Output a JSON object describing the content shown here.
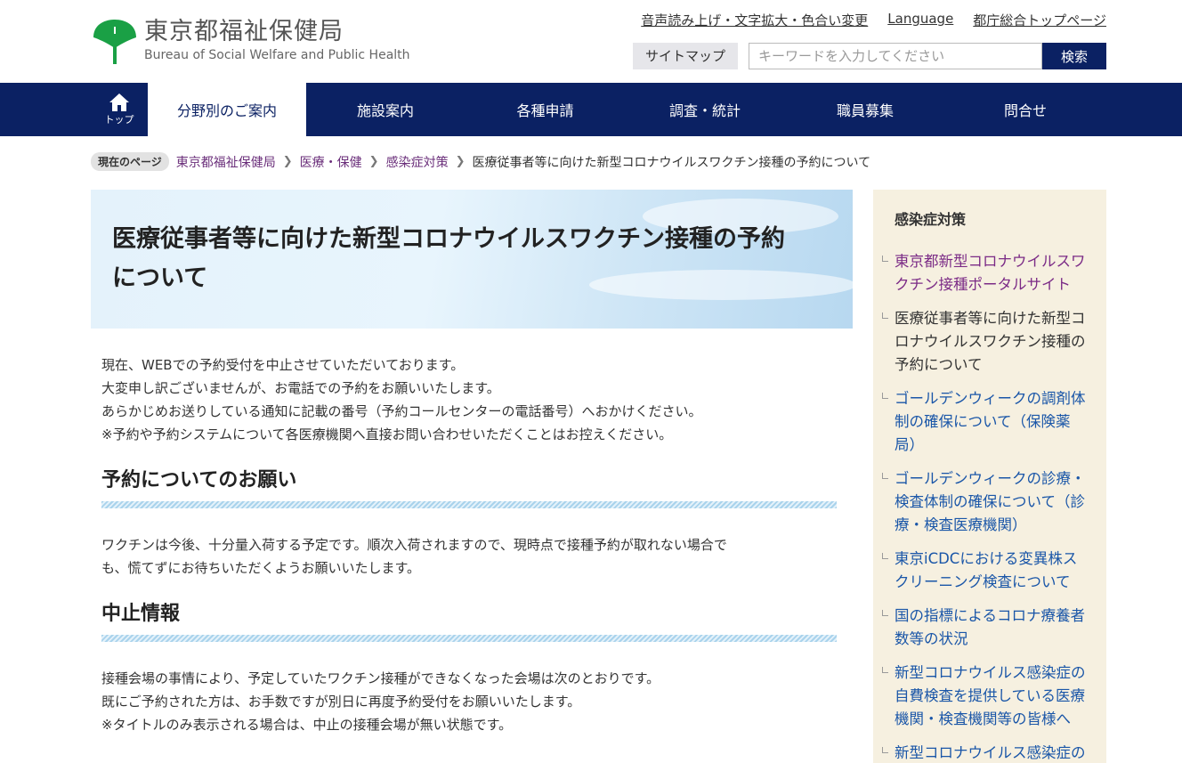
{
  "header": {
    "logo_ja": "東京都福祉保健局",
    "logo_en": "Bureau of Social Welfare and Public Health",
    "util_links": [
      "音声読み上げ・文字拡大・色合い変更",
      "Language",
      "都庁総合トップページ"
    ],
    "sitemap": "サイトマップ",
    "search_placeholder": "キーワードを入力してください",
    "search_button": "検索",
    "logo_color": "#1aa045"
  },
  "nav": {
    "home_label": "トップ",
    "items": [
      "分野別のご案内",
      "施設案内",
      "各種申請",
      "調査・統計",
      "職員募集",
      "問合せ"
    ],
    "active_index": 0,
    "color": "#0b2163"
  },
  "breadcrumb": {
    "current_label": "現在のページ",
    "links": [
      "東京都福祉保健局",
      "医療・保健",
      "感染症対策"
    ],
    "current": "医療従事者等に向けた新型コロナウイルスワクチン接種の予約について"
  },
  "main": {
    "title_line1": "医療従事者等に向けた新型コロナウイルスワクチン接種の予約",
    "title_line2": "について",
    "intro": [
      "現在、WEBでの予約受付を中止させていただいております。",
      "大変申し訳ございませんが、お電話での予約をお願いいたします。",
      "あらかじめお送りしている通知に記載の番号（予約コールセンターの電話番号）へおかけください。",
      "※予約や予約システムについて各医療機関へ直接お問い合わせいただくことはお控えください。"
    ],
    "section1": {
      "heading": "予約についてのお願い",
      "lines": [
        "ワクチンは今後、十分量入荷する予定です。順次入荷されますので、現時点で接種予約が取れない場合で",
        "も、慌てずにお待ちいただくようお願いいたします。"
      ]
    },
    "section2": {
      "heading": "中止情報",
      "lines": [
        "接種会場の事情により、予定していたワクチン接種ができなくなった会場は次のとおりです。",
        "既にご予約された方は、お手数ですが別日に再度予約受付をお願いいたします。",
        "※タイトルのみ表示される場合は、中止の接種会場が無い状態です。"
      ]
    }
  },
  "sidebar": {
    "title": "感染症対策",
    "items": [
      {
        "lines": [
          "東京都新型コロナウイルスワ",
          "クチン接種ポータルサイト"
        ],
        "state": "visited"
      },
      {
        "lines": [
          "医療従事者等に向けた新型コ",
          "ロナウイルスワクチン接種の",
          "予約について"
        ],
        "state": "current"
      },
      {
        "lines": [
          "ゴールデンウィークの調剤体",
          "制の確保について（保険薬",
          "局）"
        ],
        "state": "link"
      },
      {
        "lines": [
          "ゴールデンウィークの診療・",
          "検査体制の確保について（診",
          "療・検査医療機関）"
        ],
        "state": "link"
      },
      {
        "lines": [
          "東京iCDCにおける変異株ス",
          "クリーニング検査について"
        ],
        "state": "link"
      },
      {
        "lines": [
          "国の指標によるコロナ療養者",
          "数等の状況"
        ],
        "state": "link"
      },
      {
        "lines": [
          "新型コロナウイルス感染症の",
          "自費検査を提供している医療",
          "機関・検査機関等の皆様へ"
        ],
        "state": "link"
      },
      {
        "lines": [
          "新型コロナウイルス感染症の",
          "ー"
        ],
        "state": "link"
      }
    ]
  }
}
